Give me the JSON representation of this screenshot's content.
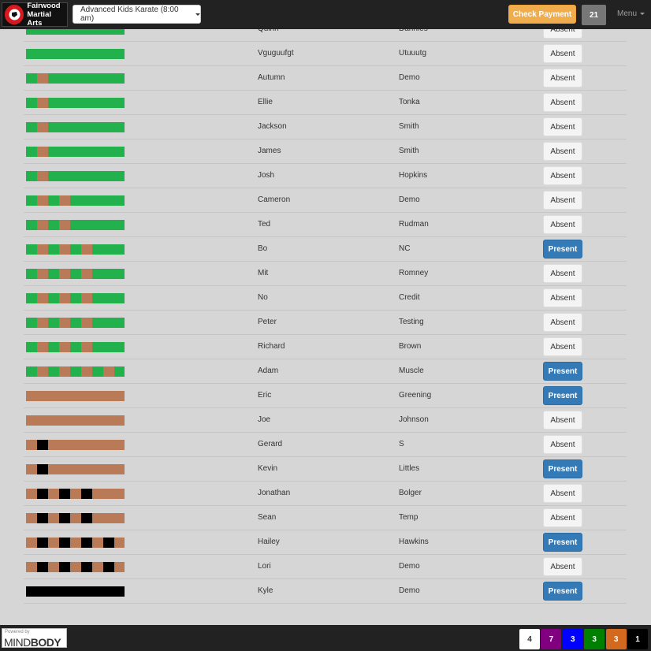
{
  "header": {
    "logo_text_line1": "Fairwood",
    "logo_text_line2": "Martial Arts",
    "class_select": "Advanced Kids Karate (8:00 am)",
    "check_payment_label": "Check Payment",
    "count": "21",
    "menu_label": "Menu"
  },
  "belt_colors": {
    "green": "#22b14c",
    "brown": "#b97a57",
    "black": "#000000"
  },
  "roster": [
    {
      "first": "Quinn",
      "last": "Dannies",
      "status": "Absent",
      "belt": "green",
      "stripes": 0,
      "stripe_color": "brown"
    },
    {
      "first": "Vguguufgt",
      "last": "Utuuutg",
      "status": "Absent",
      "belt": "green",
      "stripes": 0,
      "stripe_color": "brown"
    },
    {
      "first": "Autumn",
      "last": "Demo",
      "status": "Absent",
      "belt": "green",
      "stripes": 1,
      "stripe_color": "brown"
    },
    {
      "first": "Ellie",
      "last": "Tonka",
      "status": "Absent",
      "belt": "green",
      "stripes": 1,
      "stripe_color": "brown"
    },
    {
      "first": "Jackson",
      "last": "Smith",
      "status": "Absent",
      "belt": "green",
      "stripes": 1,
      "stripe_color": "brown"
    },
    {
      "first": "James",
      "last": "Smith",
      "status": "Absent",
      "belt": "green",
      "stripes": 1,
      "stripe_color": "brown"
    },
    {
      "first": "Josh",
      "last": "Hopkins",
      "status": "Absent",
      "belt": "green",
      "stripes": 1,
      "stripe_color": "brown"
    },
    {
      "first": "Cameron",
      "last": "Demo",
      "status": "Absent",
      "belt": "green",
      "stripes": 2,
      "stripe_color": "brown"
    },
    {
      "first": "Ted",
      "last": "Rudman",
      "status": "Absent",
      "belt": "green",
      "stripes": 2,
      "stripe_color": "brown"
    },
    {
      "first": "Bo",
      "last": "NC",
      "status": "Present",
      "belt": "green",
      "stripes": 3,
      "stripe_color": "brown"
    },
    {
      "first": "Mit",
      "last": "Romney",
      "status": "Absent",
      "belt": "green",
      "stripes": 3,
      "stripe_color": "brown"
    },
    {
      "first": "No",
      "last": "Credit",
      "status": "Absent",
      "belt": "green",
      "stripes": 3,
      "stripe_color": "brown"
    },
    {
      "first": "Peter",
      "last": "Testing",
      "status": "Absent",
      "belt": "green",
      "stripes": 3,
      "stripe_color": "brown"
    },
    {
      "first": "Richard",
      "last": "Brown",
      "status": "Absent",
      "belt": "green",
      "stripes": 3,
      "stripe_color": "brown"
    },
    {
      "first": "Adam",
      "last": "Muscle",
      "status": "Present",
      "belt": "green",
      "stripes": 4,
      "stripe_color": "brown"
    },
    {
      "first": "Eric",
      "last": "Greening",
      "status": "Present",
      "belt": "brown",
      "stripes": 0,
      "stripe_color": "black"
    },
    {
      "first": "Joe",
      "last": "Johnson",
      "status": "Absent",
      "belt": "brown",
      "stripes": 0,
      "stripe_color": "black"
    },
    {
      "first": "Gerard",
      "last": "S",
      "status": "Absent",
      "belt": "brown",
      "stripes": 1,
      "stripe_color": "black"
    },
    {
      "first": "Kevin",
      "last": "Littles",
      "status": "Present",
      "belt": "brown",
      "stripes": 1,
      "stripe_color": "black"
    },
    {
      "first": "Jonathan",
      "last": "Bolger",
      "status": "Absent",
      "belt": "brown",
      "stripes": 3,
      "stripe_color": "black"
    },
    {
      "first": "Sean",
      "last": "Temp",
      "status": "Absent",
      "belt": "brown",
      "stripes": 3,
      "stripe_color": "black"
    },
    {
      "first": "Hailey",
      "last": "Hawkins",
      "status": "Present",
      "belt": "brown",
      "stripes": 4,
      "stripe_color": "black"
    },
    {
      "first": "Lori",
      "last": "Demo",
      "status": "Absent",
      "belt": "brown",
      "stripes": 4,
      "stripe_color": "black"
    },
    {
      "first": "Kyle",
      "last": "Demo",
      "status": "Present",
      "belt": "black",
      "stripes": 0,
      "stripe_color": "black"
    }
  ],
  "footer": {
    "powered_by": "Powered by",
    "brand_light": "MIND",
    "brand_bold": "BODY",
    "counts": [
      {
        "value": "4",
        "bg": "#ffffff",
        "fg": "#333333",
        "name": "white"
      },
      {
        "value": "7",
        "bg": "#800080",
        "fg": "#ffffff",
        "name": "purple"
      },
      {
        "value": "3",
        "bg": "#0000ff",
        "fg": "#ffffff",
        "name": "blue"
      },
      {
        "value": "3",
        "bg": "#008000",
        "fg": "#ffffff",
        "name": "green"
      },
      {
        "value": "3",
        "bg": "#d2691e",
        "fg": "#ffffff",
        "name": "orange"
      },
      {
        "value": "1",
        "bg": "#000000",
        "fg": "#ffffff",
        "name": "black"
      }
    ]
  }
}
